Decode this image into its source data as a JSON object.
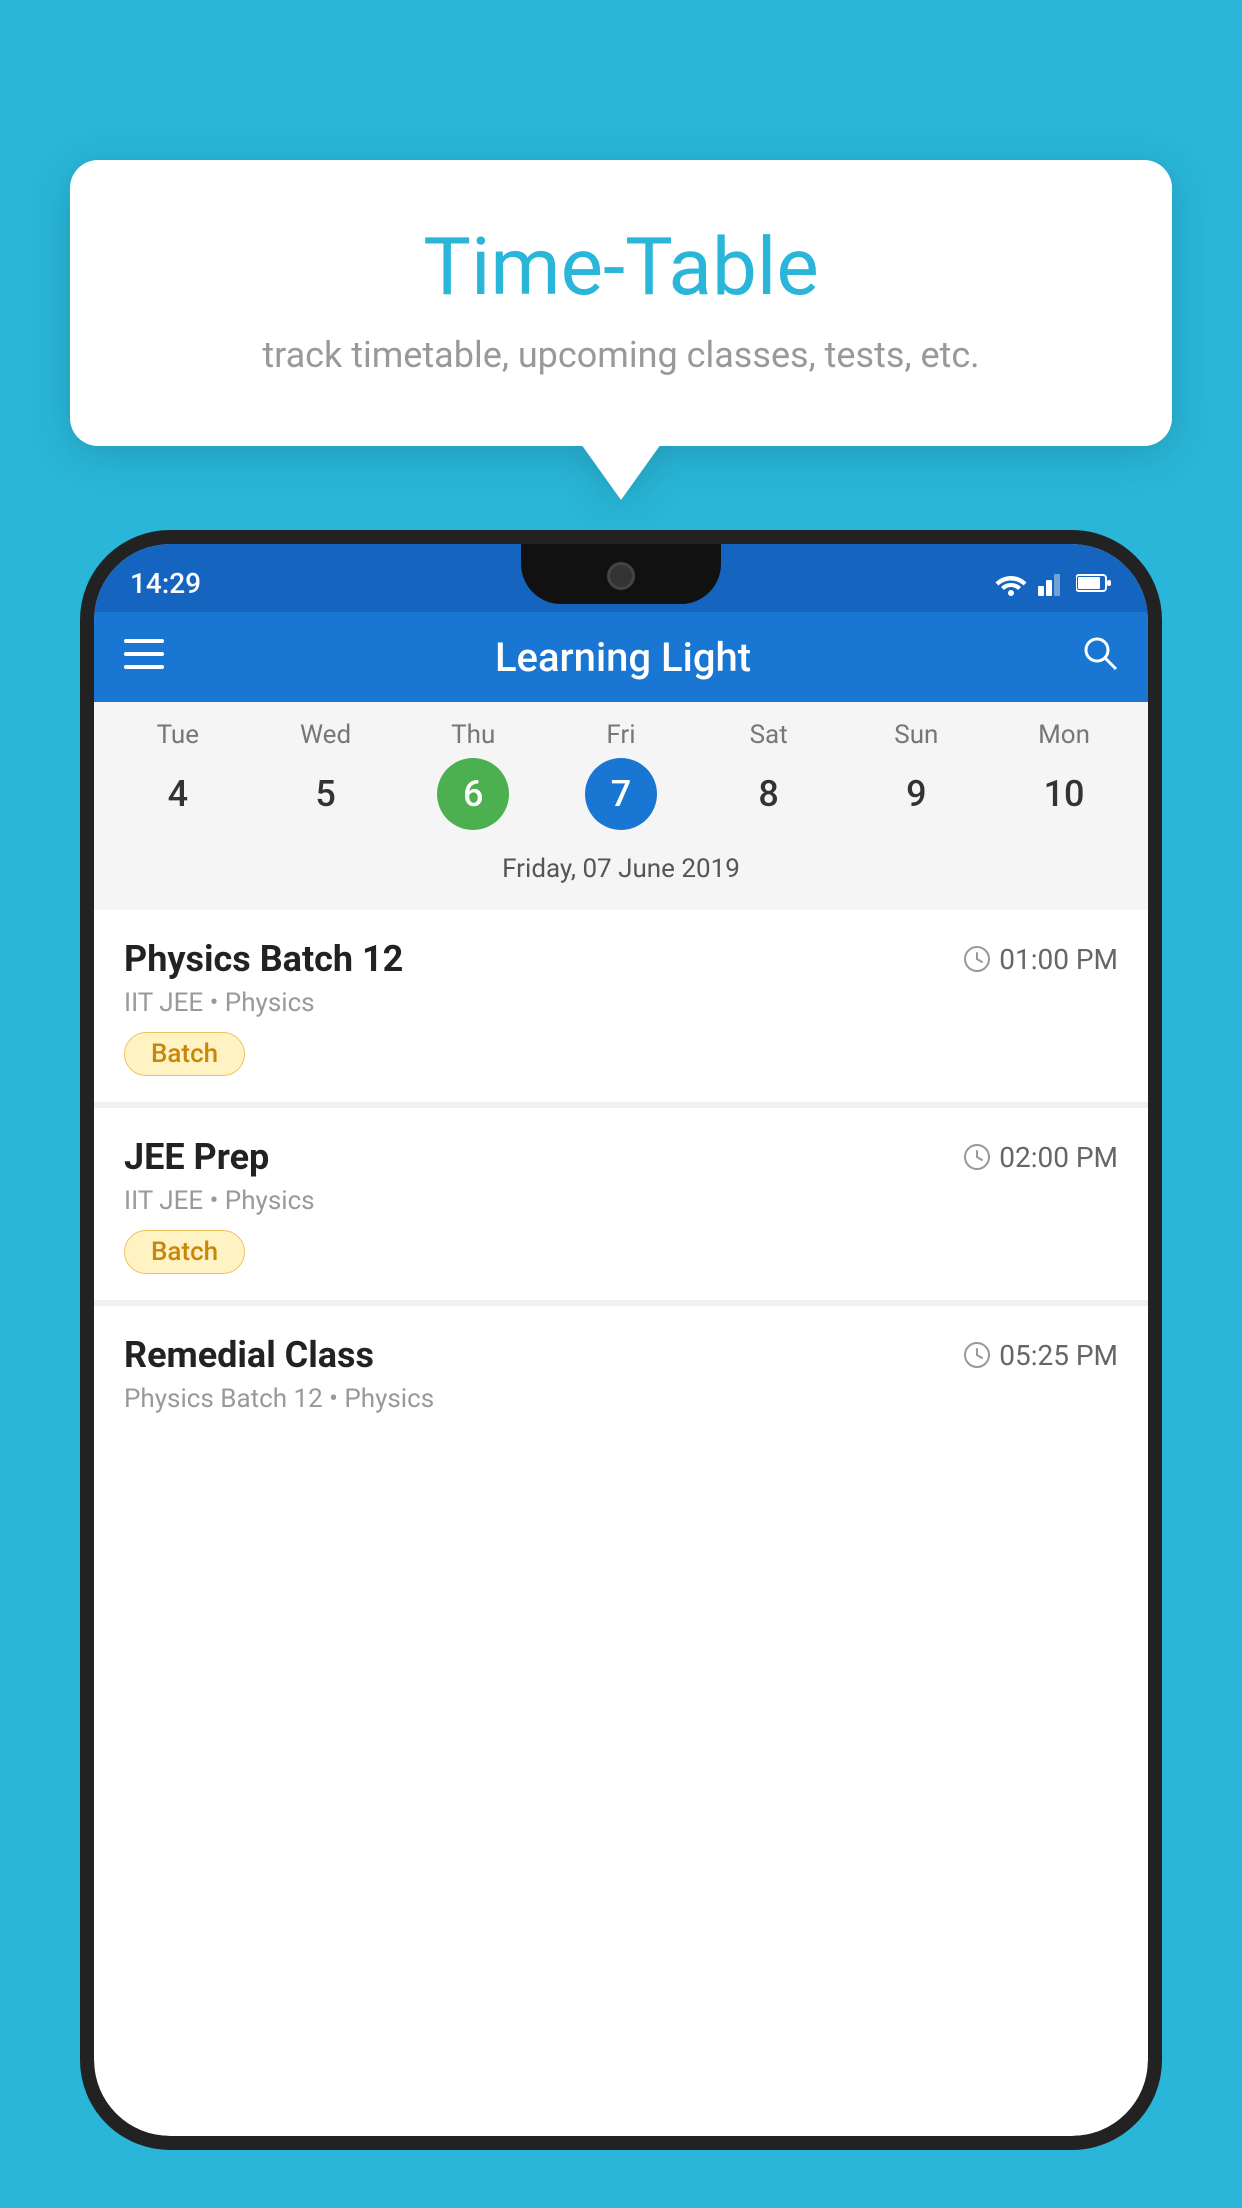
{
  "background_color": "#29B6D8",
  "tooltip": {
    "title": "Time-Table",
    "subtitle": "track timetable, upcoming classes, tests, etc."
  },
  "phone": {
    "status_bar": {
      "time": "14:29"
    },
    "header": {
      "title": "Learning Light",
      "menu_icon": "☰",
      "search_icon": "🔍"
    },
    "calendar": {
      "days": [
        {
          "label": "Tue",
          "number": "4",
          "state": "normal"
        },
        {
          "label": "Wed",
          "number": "5",
          "state": "normal"
        },
        {
          "label": "Thu",
          "number": "6",
          "state": "today"
        },
        {
          "label": "Fri",
          "number": "7",
          "state": "selected"
        },
        {
          "label": "Sat",
          "number": "8",
          "state": "normal"
        },
        {
          "label": "Sun",
          "number": "9",
          "state": "normal"
        },
        {
          "label": "Mon",
          "number": "10",
          "state": "normal"
        }
      ],
      "selected_date": "Friday, 07 June 2019"
    },
    "classes": [
      {
        "name": "Physics Batch 12",
        "time": "01:00 PM",
        "subject": "IIT JEE • Physics",
        "badge": "Batch"
      },
      {
        "name": "JEE Prep",
        "time": "02:00 PM",
        "subject": "IIT JEE • Physics",
        "badge": "Batch"
      },
      {
        "name": "Remedial Class",
        "time": "05:25 PM",
        "subject": "Physics Batch 12 • Physics",
        "badge": null
      }
    ]
  }
}
